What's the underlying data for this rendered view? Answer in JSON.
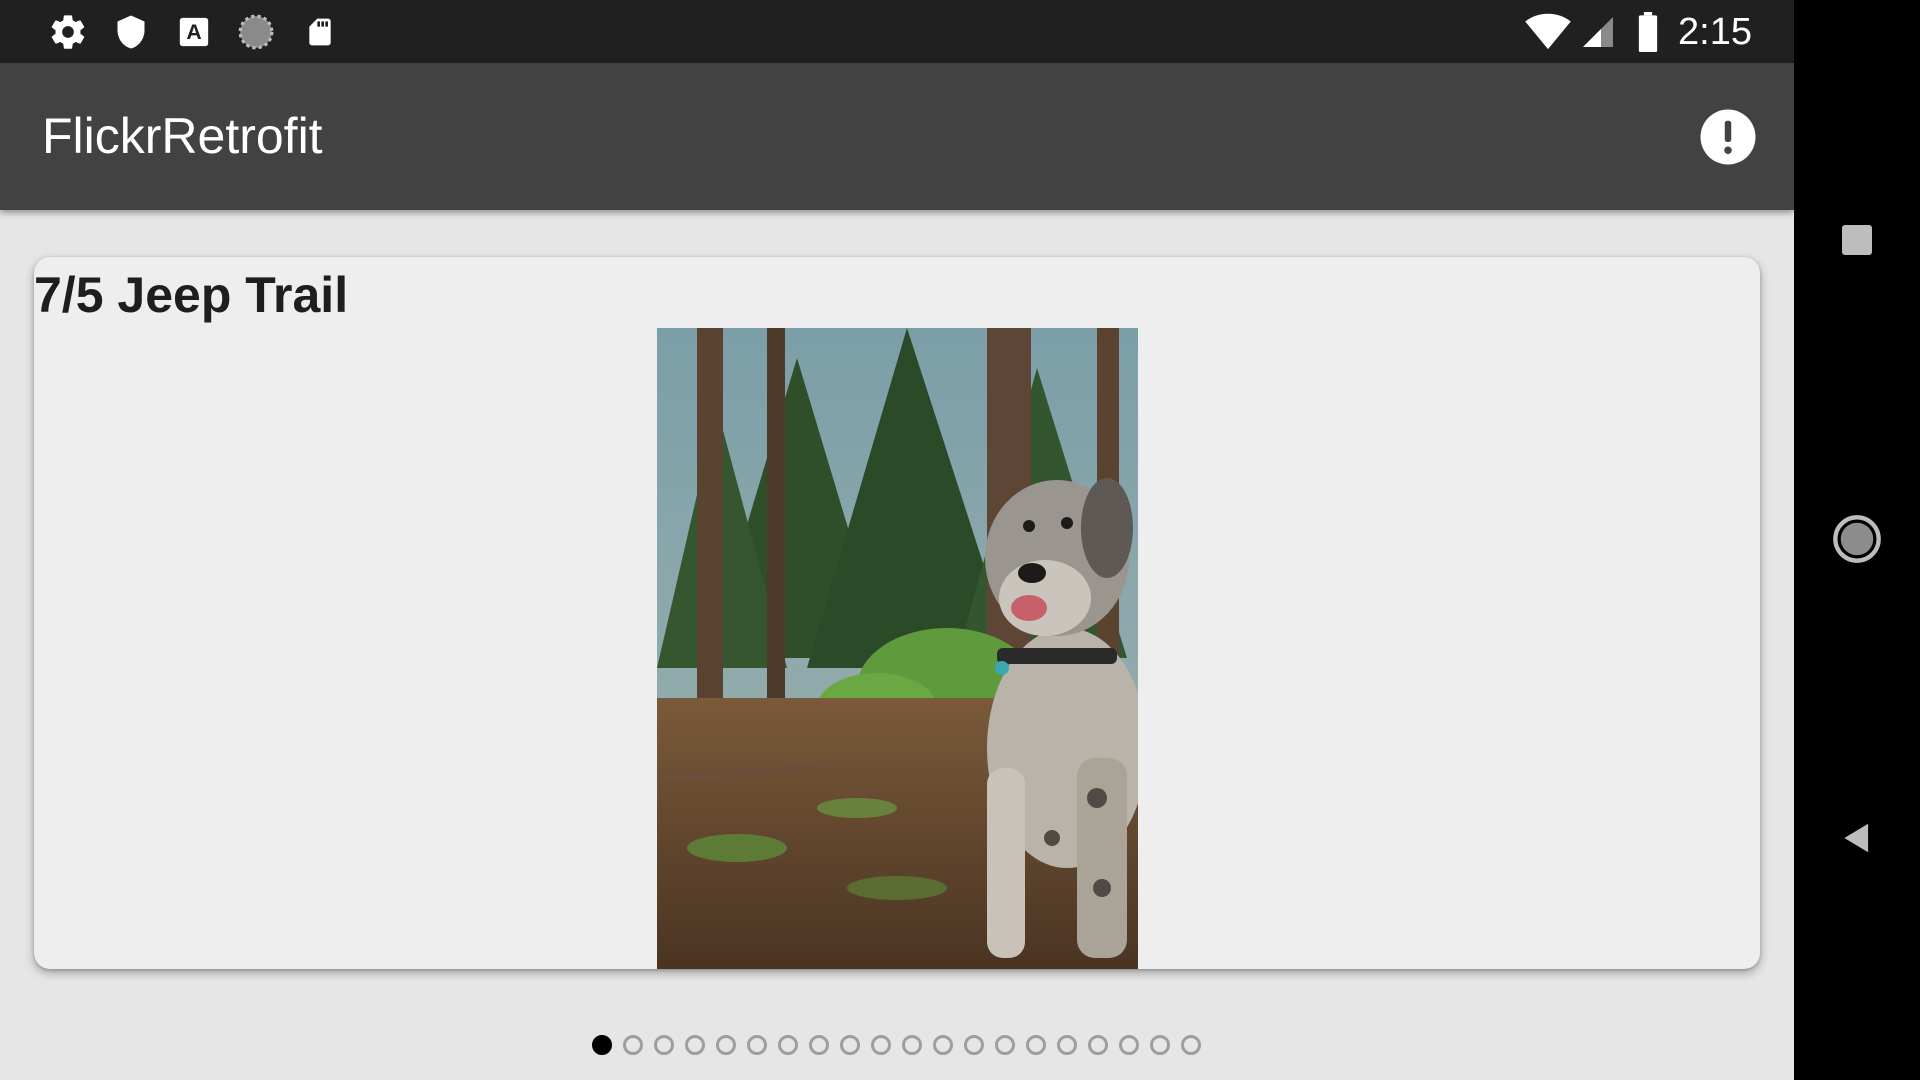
{
  "status_bar": {
    "time": "2:15",
    "left_icons": [
      "gear-icon",
      "shield-icon",
      "font-a-icon",
      "loading-circle-icon",
      "sd-card-icon"
    ],
    "right_icons": [
      "wifi-icon",
      "cell-signal-icon",
      "battery-icon"
    ]
  },
  "app_bar": {
    "title": "FlickrRetrofit",
    "action_icon": "alert-circle-icon"
  },
  "card": {
    "title": "7/5 Jeep Trail",
    "image_subject": "dog-in-forest-photo"
  },
  "pager": {
    "total_pages": 20,
    "current_page": 1
  },
  "nav_bar": {
    "buttons": [
      "recents-square-icon",
      "home-circle-icon",
      "back-triangle-icon"
    ]
  },
  "colors": {
    "status_bar_bg": "#202020",
    "app_bar_bg": "#424242",
    "content_bg": "#e6e6e6",
    "card_bg": "#eeeeee",
    "dot_active": "#000000",
    "dot_inactive": "#9e9e9e"
  }
}
